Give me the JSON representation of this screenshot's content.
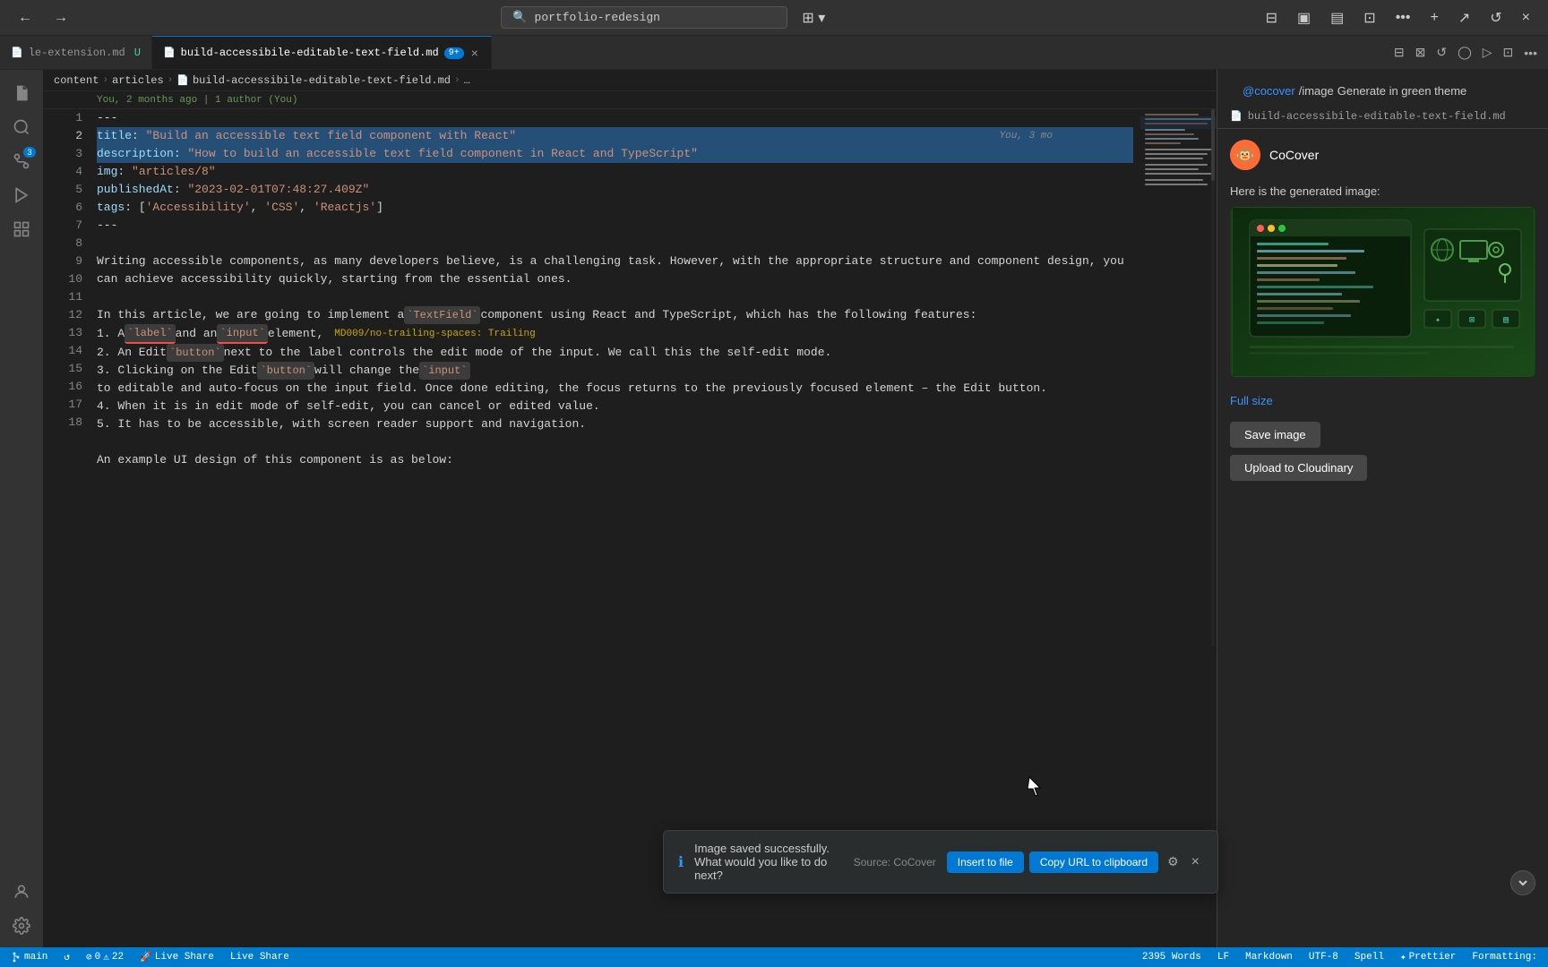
{
  "app": {
    "title": "portfolio-redesign",
    "search_placeholder": "portfolio-redesign"
  },
  "titlebar": {
    "back_label": "←",
    "forward_label": "→",
    "extensions_label": "⊞"
  },
  "tabs": [
    {
      "id": "tab1",
      "label": "le-extension.md",
      "badge": "U",
      "active": false,
      "icon": "📄"
    },
    {
      "id": "tab2",
      "label": "build-accessibile-editable-text-field.md",
      "badge": "9+",
      "active": true,
      "icon": "📄"
    }
  ],
  "tabbar_actions": [
    "⊞",
    "⊟",
    "↺",
    "◯",
    "▷",
    "⊡",
    "•••"
  ],
  "breadcrumb": {
    "items": [
      "content",
      "articles",
      "build-accessibile-editable-text-field.md",
      "…"
    ]
  },
  "git_blame": "You, 2 months ago | 1 author (You)",
  "editor": {
    "lines": [
      {
        "num": 1,
        "content": "---",
        "type": "plain"
      },
      {
        "num": 2,
        "content": "title: \"Build an accessible text field component with React\"",
        "type": "yaml",
        "selected": true,
        "git": "You, 3 mo"
      },
      {
        "num": 3,
        "content": "description: \"How to build an accessible text field component in React and TypeScript\"",
        "type": "yaml",
        "selected": true
      },
      {
        "num": 4,
        "content": "img: \"articles/8\"",
        "type": "yaml"
      },
      {
        "num": 5,
        "content": "publishedAt: \"2023-02-01T07:48:27.409Z\"",
        "type": "yaml"
      },
      {
        "num": 6,
        "content": "tags: ['Accessibility', 'CSS', 'Reactjs']",
        "type": "yaml"
      },
      {
        "num": 7,
        "content": "---",
        "type": "plain"
      },
      {
        "num": 8,
        "content": "",
        "type": "plain"
      },
      {
        "num": 9,
        "content": "Writing accessible components, as many developers believe, is a challenging task. However, with the appropriate structure and component design, you can achieve accessibility quickly, starting from the essential ones.",
        "type": "text"
      },
      {
        "num": 10,
        "content": "",
        "type": "plain"
      },
      {
        "num": 11,
        "content": "In this article, we are going to implement a `TextField` component using React and TypeScript, which has the following features:",
        "type": "text"
      },
      {
        "num": 12,
        "content": "1. A `label` and an `input` element,",
        "type": "text",
        "warning": true,
        "warning_text": "MD009/no-trailing-spaces: Trailing"
      },
      {
        "num": 13,
        "content": "2. An Edit `button` next to the label controls the edit mode of the input. We call this the self-edit mode.",
        "type": "text"
      },
      {
        "num": 14,
        "content": "3. Clicking on the Edit `button` will change the `input` to editable and auto-focus on the input field. Once done editing, the focus returns to the previously focused element – the Edit button.",
        "type": "text"
      },
      {
        "num": 15,
        "content": "4. When it is in edit mode of self-edit, you can cancel or edited value.",
        "type": "text"
      },
      {
        "num": 16,
        "content": "5. It has to be accessible, with screen reader support and navigation.",
        "type": "text"
      },
      {
        "num": 17,
        "content": "",
        "type": "plain"
      },
      {
        "num": 18,
        "content": "An example UI design of this component is as below:",
        "type": "text"
      }
    ]
  },
  "right_panel": {
    "prompt": {
      "tag": "@cocover",
      "path": "/image",
      "description": "Generate in green theme"
    },
    "file_ref": "build-accessibile-editable-text-field.md",
    "agent_name": "CoCover",
    "agent_message": "Here is the generated image:",
    "full_size_label": "Full size",
    "save_image_label": "Save image",
    "upload_label": "Upload to Cloudinary"
  },
  "notification": {
    "message": "Image saved successfully. What would you like to do next?",
    "source": "Source: CoCover",
    "insert_label": "Insert to file",
    "copy_label": "Copy URL to clipboard"
  },
  "statusbar": {
    "branch": "main",
    "errors": "0",
    "warnings": "22",
    "live_share": "Live Share",
    "words": "2395 Words",
    "line_ending": "LF",
    "language": "Markdown",
    "encoding": "UTF-8",
    "spell": "Spell",
    "prettier": "Prettier",
    "formatting": "Formatting:"
  }
}
